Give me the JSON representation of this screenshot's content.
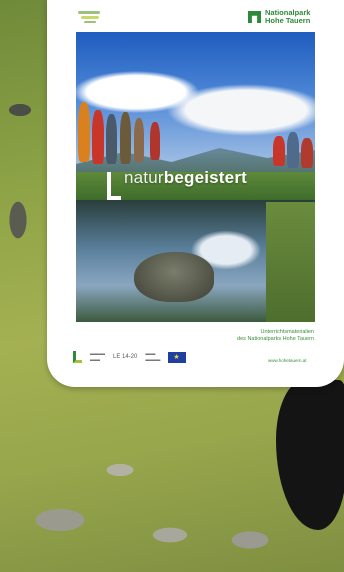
{
  "brochure": {
    "publisher_logo_line1": "Nationalpark",
    "publisher_logo_line2": "Hohe Tauern",
    "slogan_light": "natur",
    "slogan_bold": "begeistert",
    "subtitle_line1": "Unterrichtsmaterialien",
    "subtitle_line2": "des Nationalparks Hohe Tauern",
    "footer_logo_text": "LE 14-20",
    "website": "www.hohetauern.at"
  },
  "colors": {
    "brand_green": "#2e8a3a",
    "accent_lime": "#a4c23b",
    "sky_blue": "#1f5dbf"
  },
  "icons": {
    "publisher_logo": "nationalpark-logo-icon",
    "eu_flag": "eu-flag-icon",
    "ministry_logo": "bmlfuw-logo-icon"
  }
}
